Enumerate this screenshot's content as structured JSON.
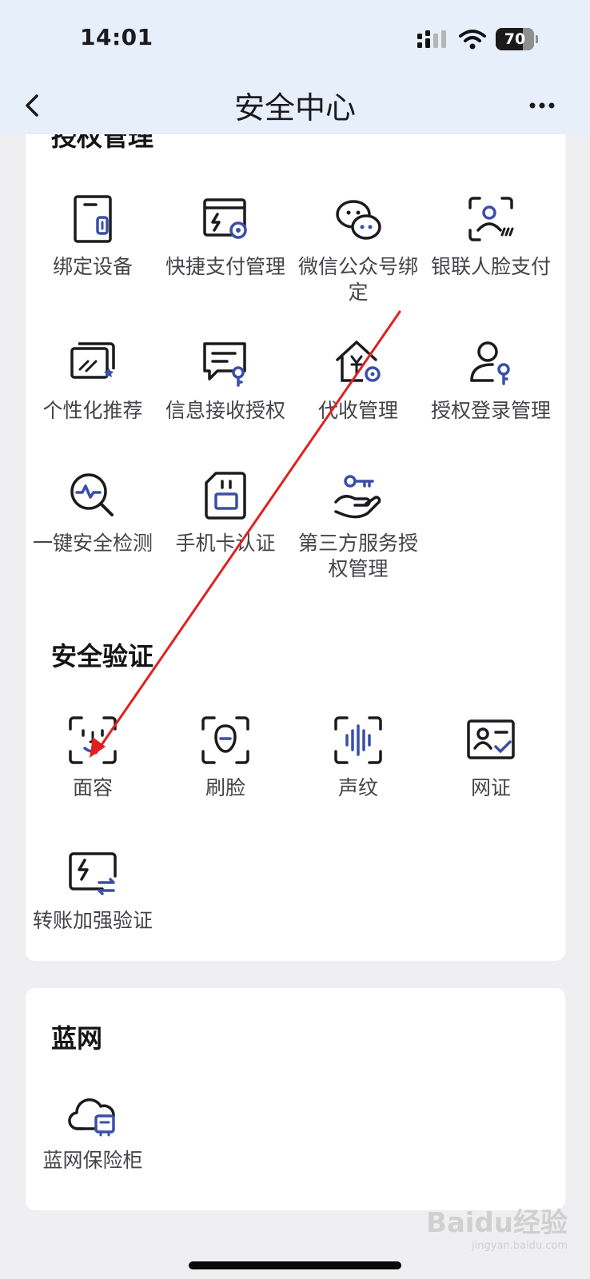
{
  "status_bar": {
    "time": "14:01",
    "battery": "70",
    "battery_level": 0.7
  },
  "nav": {
    "title": "安全中心"
  },
  "sections": {
    "auth": {
      "title": "授权管理",
      "items": [
        {
          "label": "绑定设备",
          "icon": "device-bind-icon"
        },
        {
          "label": "快捷支付管理",
          "icon": "quick-pay-icon"
        },
        {
          "label": "微信公众号绑定",
          "icon": "wechat-icon"
        },
        {
          "label": "银联人脸支付",
          "icon": "face-pay-icon"
        },
        {
          "label": "个性化推荐",
          "icon": "recommend-icon"
        },
        {
          "label": "信息接收授权",
          "icon": "message-auth-icon"
        },
        {
          "label": "代收管理",
          "icon": "collect-house-icon"
        },
        {
          "label": "授权登录管理",
          "icon": "user-key-icon"
        },
        {
          "label": "一键安全检测",
          "icon": "security-scan-icon"
        },
        {
          "label": "手机卡认证",
          "icon": "sim-card-icon"
        },
        {
          "label": "第三方服务授权管理",
          "icon": "hand-key-icon"
        }
      ]
    },
    "verify": {
      "title": "安全验证",
      "items": [
        {
          "label": "面容",
          "icon": "face-id-icon"
        },
        {
          "label": "刷脸",
          "icon": "face-scan-icon"
        },
        {
          "label": "声纹",
          "icon": "voiceprint-icon"
        },
        {
          "label": "网证",
          "icon": "net-id-icon"
        },
        {
          "label": "转账加强验证",
          "icon": "transfer-verify-icon"
        }
      ]
    },
    "blue_net": {
      "title": "蓝网",
      "items": [
        {
          "label": "蓝网保险柜",
          "icon": "cloud-safe-icon"
        }
      ]
    }
  },
  "watermark": {
    "brand": "Baidu经验",
    "sub": "jingyan.baidu.com"
  },
  "colors": {
    "accent": "#3a4fa8",
    "ink": "#1b1b1f",
    "header_bg": "#e6effa",
    "page_bg": "#efeff1",
    "annotation": "#e02020"
  }
}
